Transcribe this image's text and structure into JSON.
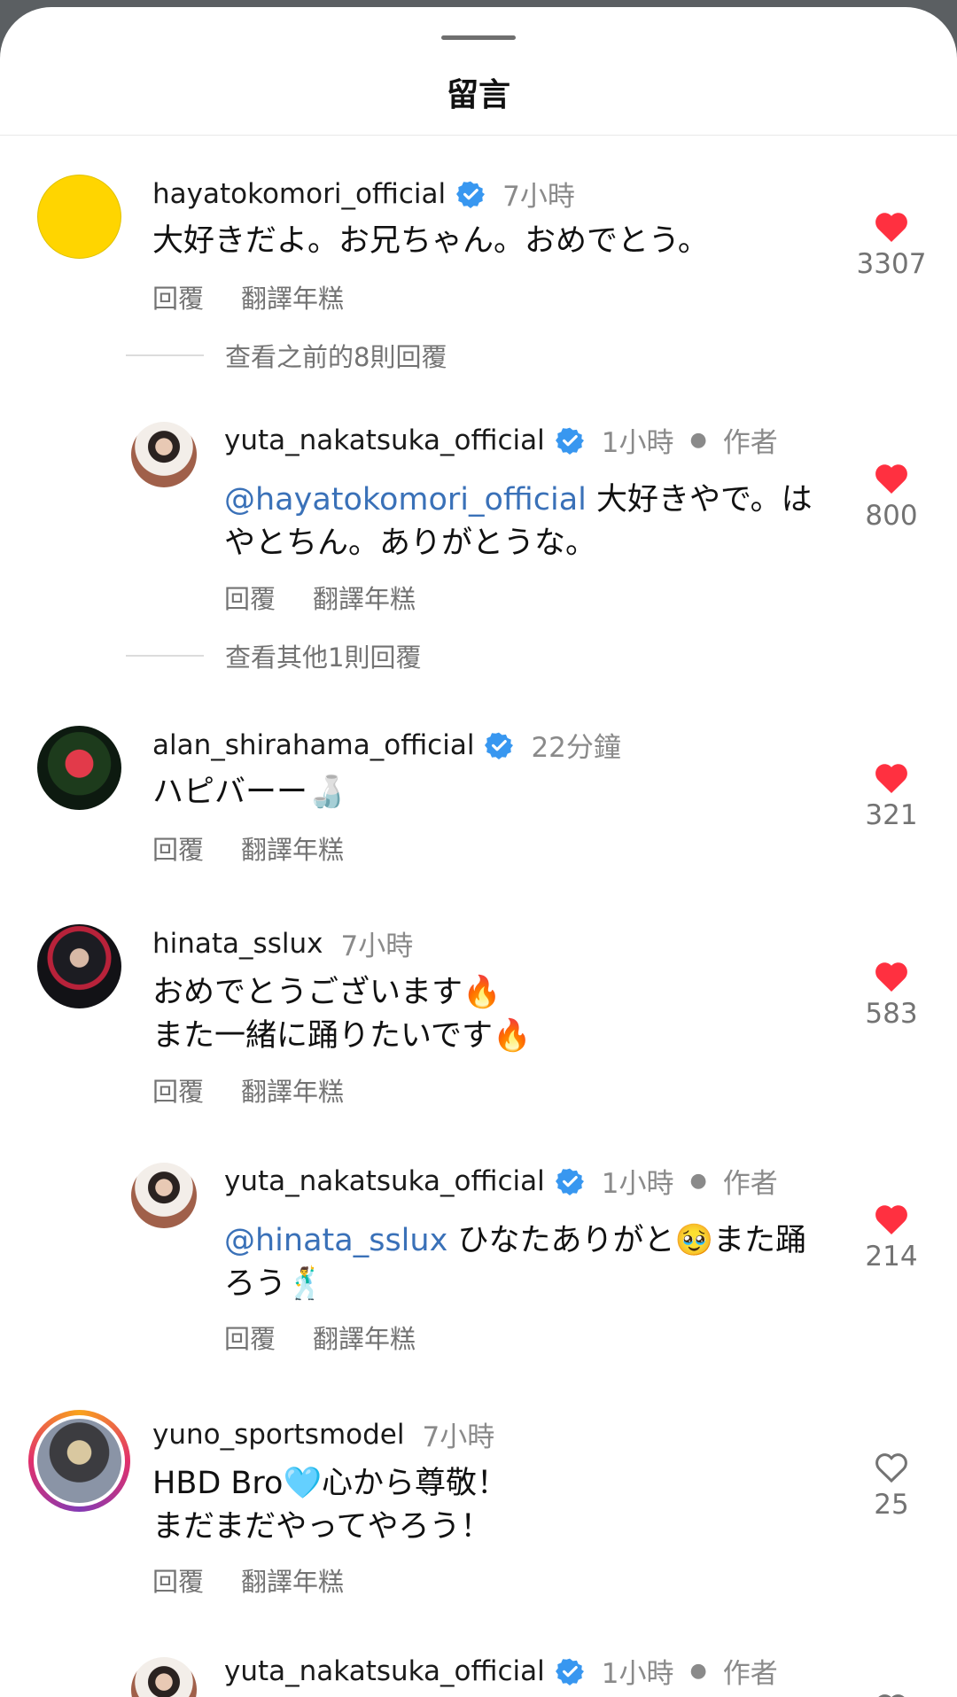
{
  "sheet": {
    "title": "留言"
  },
  "labels": {
    "reply": "回覆",
    "translate": "翻譯年糕",
    "author": "作者"
  },
  "comments": [
    {
      "username": "hayatokomori_official",
      "verified": true,
      "time": "7小時",
      "text": "大好きだよ。お兄ちゃん。おめでとう。",
      "likes": "3307",
      "liked": true
    },
    {
      "username": "yuta_nakatsuka_official",
      "verified": true,
      "time": "1小時",
      "is_author": true,
      "mention": "@hayatokomori_official",
      "text": " 大好きやで。は\nやとちん。ありがとうな。",
      "likes": "800",
      "liked": true
    },
    {
      "username": "alan_shirahama_official",
      "verified": true,
      "time": "22分鐘",
      "text": "ハピバーー🍶",
      "likes": "321",
      "liked": true
    },
    {
      "username": "hinata_sslux",
      "verified": false,
      "time": "7小時",
      "text": "おめでとうございます🔥\nまた一緒に踊りたいです🔥",
      "likes": "583",
      "liked": true
    },
    {
      "username": "yuta_nakatsuka_official",
      "verified": true,
      "time": "1小時",
      "is_author": true,
      "mention": "@hinata_sslux",
      "text": " ひなたありがと🥹また踊\nろう🕺",
      "likes": "214",
      "liked": true
    },
    {
      "username": "yuno_sportsmodel",
      "verified": false,
      "time": "7小時",
      "text": "HBD Bro🩵心から尊敬！\nまだまだやってやろう！",
      "likes": "25",
      "liked": false
    },
    {
      "username": "yuta_nakatsuka_official",
      "verified": true,
      "time": "1小時",
      "is_author": true
    }
  ],
  "view_more": [
    {
      "text": "查看之前的8則回覆"
    },
    {
      "text": "查看其他1則回覆"
    }
  ],
  "colors": {
    "like_red": "#ff3040",
    "verified_blue": "#3897f0",
    "mention_blue": "#3a71b8"
  }
}
